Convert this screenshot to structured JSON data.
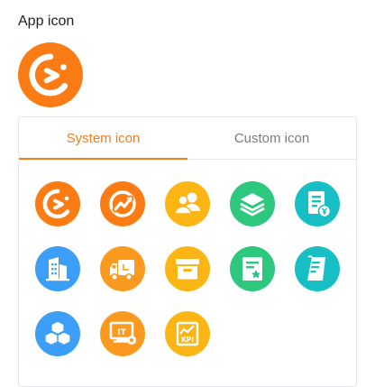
{
  "header": {
    "label": "App icon"
  },
  "preview": {
    "icon": "pacman-chart-icon",
    "color": "#fb7c14"
  },
  "tabs": [
    {
      "label": "System icon",
      "active": true
    },
    {
      "label": "Custom icon",
      "active": false
    }
  ],
  "icons": [
    {
      "name": "pacman-chart-icon",
      "color": "#fb7c14"
    },
    {
      "name": "growth-arrow-icon",
      "color": "#fb7c14"
    },
    {
      "name": "users-group-icon",
      "color": "#fbb514"
    },
    {
      "name": "layers-stack-icon",
      "color": "#2dc77e"
    },
    {
      "name": "invoice-money-icon",
      "color": "#17bfc4"
    },
    {
      "name": "office-building-icon",
      "color": "#3c9ef7"
    },
    {
      "name": "delivery-truck-icon",
      "color": "#fb9a1f"
    },
    {
      "name": "archive-box-icon",
      "color": "#fbb514"
    },
    {
      "name": "certificate-star-icon",
      "color": "#2dc77e"
    },
    {
      "name": "document-scroll-icon",
      "color": "#17bfc4"
    },
    {
      "name": "cubes-icon",
      "color": "#3c9ef7"
    },
    {
      "name": "it-settings-icon",
      "color": "#fb9a1f"
    },
    {
      "name": "kpi-chart-icon",
      "color": "#fbb514"
    }
  ]
}
